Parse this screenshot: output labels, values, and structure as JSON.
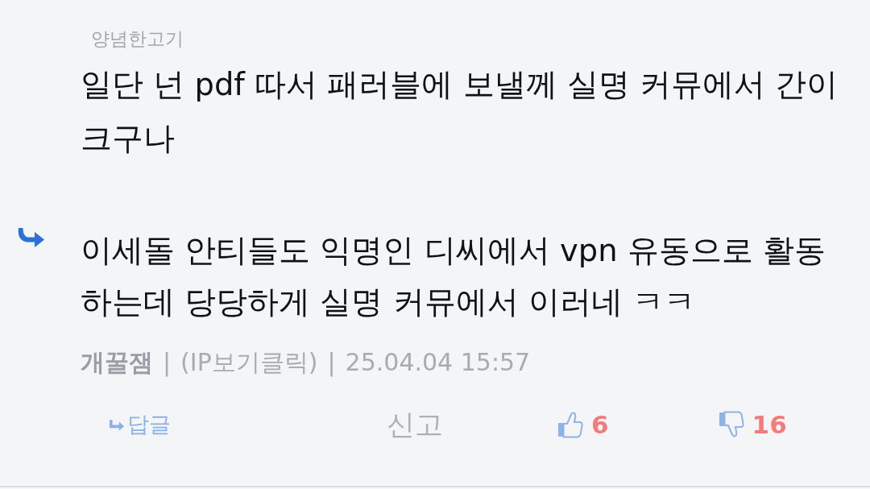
{
  "parent_comment": {
    "author": "양념한고기",
    "text": "일단 넌 pdf 따서 패러블에 보낼께 실명 커뮤에서 간이 크구나"
  },
  "comment": {
    "text": "이세돌 안티들도 익명인 디씨에서 vpn 유동으로 활동하는데 당당하게 실명 커뮤에서 이러네 ㅋㅋ",
    "meta": [
      {
        "kind": "author",
        "text": "개꿀잼"
      },
      {
        "kind": "separator",
        "text": "|"
      },
      {
        "kind": "ip_link",
        "text": "(IP보기클릭)"
      },
      {
        "kind": "separator",
        "text": "|"
      },
      {
        "kind": "date",
        "text": "25.04.04 15:57"
      }
    ]
  },
  "actions": {
    "reply": "답글",
    "report": "신고",
    "likes": "6",
    "dislikes": "16"
  }
}
